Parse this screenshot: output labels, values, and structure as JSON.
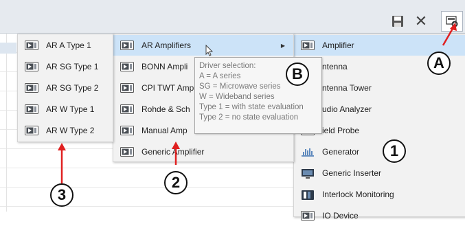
{
  "toolbar": {
    "save_icon": "save-icon",
    "close_icon": "close-icon",
    "add_icon": "add-device-icon"
  },
  "menu_devices": {
    "items": [
      {
        "label": "Amplifier",
        "icon": "device-icon",
        "highlighted": true
      },
      {
        "label": "ntenna",
        "icon": "device-icon"
      },
      {
        "label": "ntenna Tower",
        "icon": "device-icon"
      },
      {
        "label": "udio Analyzer",
        "icon": "device-icon"
      },
      {
        "label": "ield Probe",
        "icon": "device-icon"
      },
      {
        "label": "Generator",
        "icon": "generator-icon"
      },
      {
        "label": "Generic Inserter",
        "icon": "monitor-icon"
      },
      {
        "label": "Interlock Monitoring",
        "icon": "interlock-icon"
      },
      {
        "label": "IO Device",
        "icon": "device-icon"
      }
    ]
  },
  "menu_amplifiers": {
    "items": [
      {
        "label": "AR Amplifiers",
        "icon": "device-icon",
        "highlighted": true,
        "submenu": true
      },
      {
        "label": "BONN Ampli",
        "icon": "device-icon"
      },
      {
        "label": "CPI TWT Amp",
        "icon": "device-icon"
      },
      {
        "label": "Rohde & Sch",
        "icon": "device-icon"
      },
      {
        "label": "Manual Amp",
        "icon": "device-icon"
      },
      {
        "label": "Generic Amplifier",
        "icon": "device-icon"
      }
    ]
  },
  "menu_ar_types": {
    "items": [
      {
        "label": "AR A Type 1",
        "icon": "device-icon"
      },
      {
        "label": "AR SG Type 1",
        "icon": "device-icon"
      },
      {
        "label": "AR SG Type 2",
        "icon": "device-icon"
      },
      {
        "label": "AR W Type 1",
        "icon": "device-icon"
      },
      {
        "label": "AR W Type 2",
        "icon": "device-icon"
      }
    ]
  },
  "tooltip": {
    "lines": [
      "Driver selection:",
      "A = A series",
      "SG = Microwave series",
      "W = Wideband series",
      "Type 1 = with state evaluation",
      "Type 2 = no state evaluation"
    ]
  },
  "callouts": {
    "a": "A",
    "b": "B",
    "one": "1",
    "two": "2",
    "three": "3"
  },
  "colors": {
    "highlight": "#cce3f8",
    "menu_bg": "#f2f2f2",
    "arrow": "#e02020",
    "tooltip_text": "#7a7a7a"
  }
}
